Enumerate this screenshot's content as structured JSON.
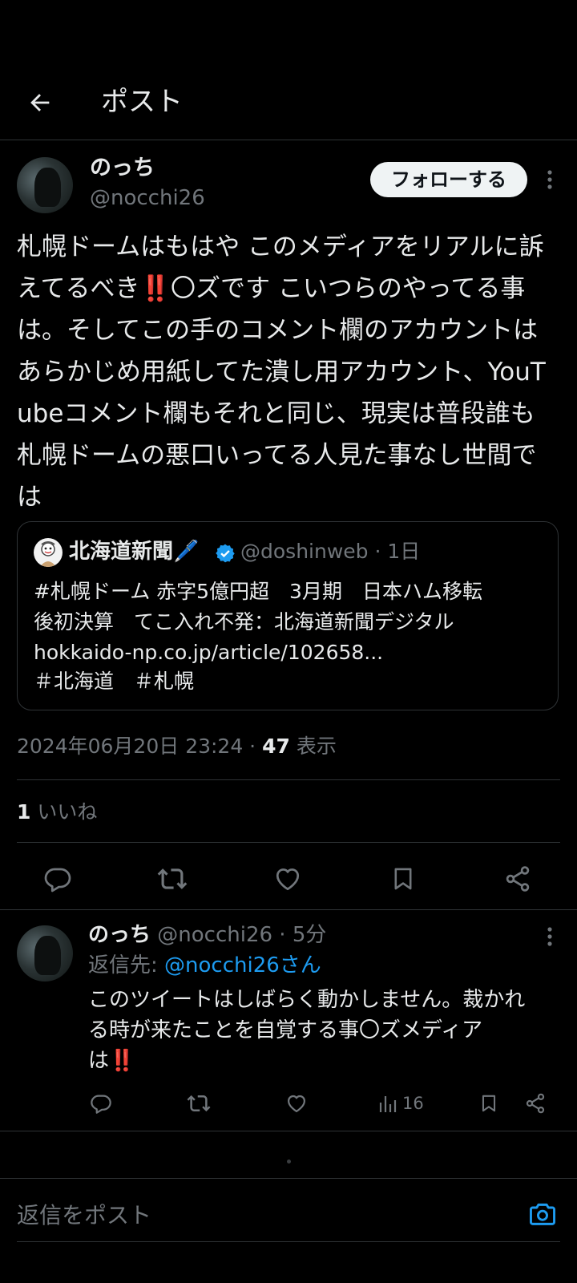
{
  "header": {
    "title": "ポスト"
  },
  "post": {
    "display_name": "のっち",
    "handle": "@nocchi26",
    "follow_label": "フォローする",
    "text": "札幌ドームはもはや このメディアをリアルに訴えてるべき‼️〇ズです こいつらのやってる事は。そしてこの手のコメント欄のアカウントはあらかじめ用紙してた潰し用アカウント、YouTubeコメント欄もそれと同じ、現実は普段誰も札幌ドームの悪口いってる人見た事なし世間では",
    "timestamp": "2024年06月20日 23:24 · ",
    "views_count": "47",
    "views_label": " 表示",
    "likes_count": "1",
    "likes_label": " いいね"
  },
  "quote": {
    "name": "北海道新聞🖊️",
    "handle_time": "@doshinweb · 1日",
    "line1": "#札幌ドーム 赤字5億円超　3月期　日本ハム移転",
    "line2": "後初決算　てこ入れ不発：北海道新聞デジタル",
    "line3": "hokkaido-np.co.jp/article/102658...",
    "line4": " ＃北海道　＃札幌"
  },
  "reply": {
    "display_name": "のっち",
    "handle_time": " @nocchi26 · 5分",
    "reply_to_prefix": "返信先: ",
    "reply_to_handle": "@nocchi26さん",
    "text_line1": "このツイートはしばらく動かしません。裁かれ",
    "text_line2": "る時が来たことを自覚する事〇ズメディア",
    "text_line3": "は‼️",
    "views": "16"
  },
  "composer": {
    "placeholder": "返信をポスト"
  },
  "colors": {
    "background": "#000000",
    "text": "#e7e9ea",
    "muted": "#71767b",
    "accent": "#1d9bf0",
    "divider": "#2f3336"
  }
}
